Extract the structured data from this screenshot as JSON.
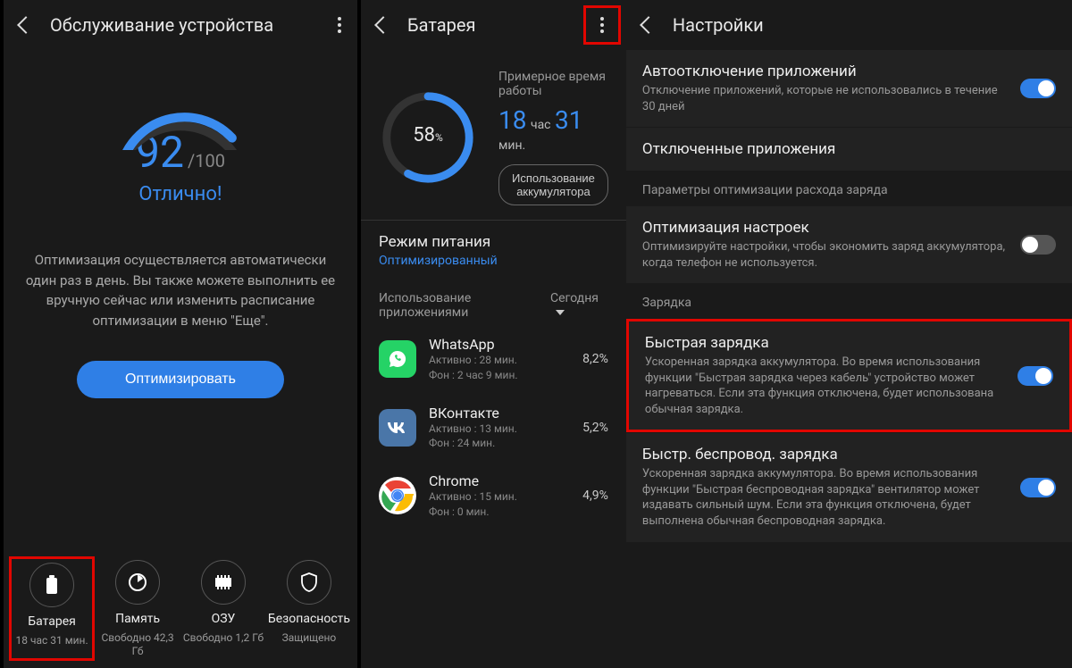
{
  "pane1": {
    "title": "Обслуживание устройства",
    "score": "92",
    "score_max": "/100",
    "score_label": "Отлично!",
    "desc": "Оптимизация осуществляется автоматически один раз в день. Вы также можете выполнить ее вручную сейчас или изменить расписание оптимизации в меню \"Еще\".",
    "opt_btn": "Оптимизировать",
    "tiles": [
      {
        "label": "Батарея",
        "sub": "18 час 31 мин."
      },
      {
        "label": "Память",
        "sub": "Свободно 42,3 Гб"
      },
      {
        "label": "ОЗУ",
        "sub": "Свободно 1,2 Гб"
      },
      {
        "label": "Безопасность",
        "sub": "Защищено"
      }
    ]
  },
  "pane2": {
    "title": "Батарея",
    "pct": "58",
    "pct_unit": "%",
    "est_label": "Примерное время работы",
    "est_h": "18",
    "est_h_u": "час",
    "est_m": "31",
    "est_m_u": "мин.",
    "usage_btn": "Использование аккумулятора",
    "mode_t": "Режим питания",
    "mode_s": "Оптимизированный",
    "usage_head_l": "Использование приложениями",
    "usage_head_r": "Сегодня",
    "apps": [
      {
        "name": "WhatsApp",
        "active": "Активно : 28 мин.",
        "bg": "Фон : 2 час 9 мин.",
        "pct": "8,2%",
        "color": "#25D366"
      },
      {
        "name": "ВКонтакте",
        "active": "Активно : 13 мин.",
        "bg": "Фон : 24 мин.",
        "pct": "5,2%",
        "color": "#4a76a8"
      },
      {
        "name": "Chrome",
        "active": "Активно : 15 мин.",
        "bg": "Фон : 0 мин.",
        "pct": "4,9%",
        "color": "#fff"
      }
    ]
  },
  "pane3": {
    "title": "Настройки",
    "s1_t": "Автоотключение приложений",
    "s1_s": "Отключение приложений, которые не использовались в течение 30 дней",
    "s2_t": "Отключенные приложения",
    "sh1": "Параметры оптимизации расхода заряда",
    "s3_t": "Оптимизация настроек",
    "s3_s": "Оптимизируйте настройки, чтобы экономить заряд аккумулятора, когда телефон не используется.",
    "sh2": "Зарядка",
    "s4_t": "Быстрая зарядка",
    "s4_s": "Ускоренная зарядка аккумулятора. Во время использования функции \"Быстрая зарядка через кабель\" устройство может нагреваться. Если эта функция отключена, будет использована обычная зарядка.",
    "s5_t": "Быстр. беспровод. зарядка",
    "s5_s": "Ускоренная зарядка аккумулятора. Во время использования функции \"Быстрая беспроводная зарядка\" вентилятор может издавать сильный шум. Если эта функция отключена, будет выполнена обычная беспроводная зарядка."
  }
}
